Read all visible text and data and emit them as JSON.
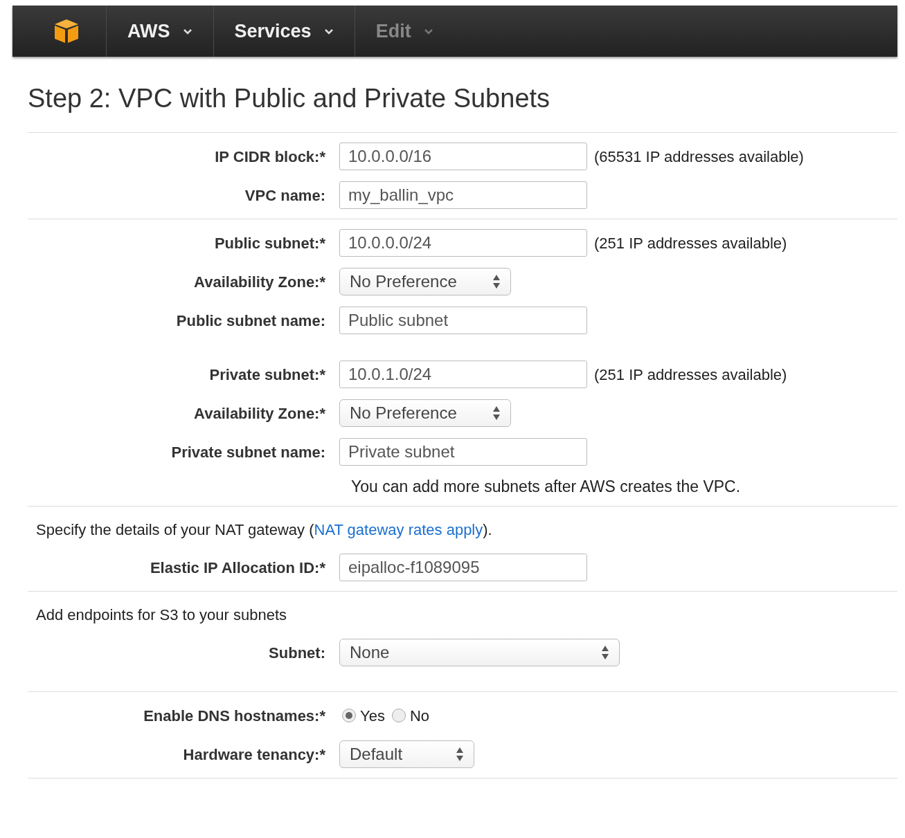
{
  "nav": {
    "items": [
      {
        "label": "AWS",
        "disabled": false
      },
      {
        "label": "Services",
        "disabled": false
      },
      {
        "label": "Edit",
        "disabled": true
      }
    ]
  },
  "title": "Step 2: VPC with Public and Private Subnets",
  "sections": [
    {
      "rows": [
        {
          "kind": "text",
          "label": "IP CIDR block:*",
          "value": "10.0.0.0/16",
          "hint": "(65531 IP addresses available)"
        },
        {
          "kind": "text",
          "label": "VPC name:",
          "value": "my_ballin_vpc"
        }
      ]
    },
    {
      "rows": [
        {
          "kind": "text",
          "label": "Public subnet:*",
          "value": "10.0.0.0/24",
          "hint": "(251 IP addresses available)"
        },
        {
          "kind": "select",
          "label": "Availability Zone:*",
          "value": "No Preference"
        },
        {
          "kind": "text",
          "label": "Public subnet name:",
          "value": "Public subnet"
        },
        {
          "kind": "gap"
        },
        {
          "kind": "text",
          "label": "Private subnet:*",
          "value": "10.0.1.0/24",
          "hint": "(251 IP addresses available)"
        },
        {
          "kind": "select",
          "label": "Availability Zone:*",
          "value": "No Preference"
        },
        {
          "kind": "text",
          "label": "Private subnet name:",
          "value": "Private subnet"
        },
        {
          "kind": "note",
          "text": "You can add more subnets after AWS creates the VPC."
        }
      ]
    },
    {
      "intro": {
        "before": "Specify the details of your NAT gateway (",
        "link": "NAT gateway rates apply",
        "after": ")."
      },
      "rows": [
        {
          "kind": "text",
          "label": "Elastic IP Allocation ID:*",
          "value": "eipalloc-f1089095"
        }
      ]
    },
    {
      "intro": {
        "before": "Add endpoints for S3 to your subnets"
      },
      "rows": [
        {
          "kind": "wideselect",
          "label": "Subnet:",
          "value": "None"
        },
        {
          "kind": "gap"
        }
      ]
    },
    {
      "rows": [
        {
          "kind": "radio",
          "label": "Enable DNS hostnames:*",
          "options": [
            {
              "label": "Yes",
              "selected": true
            },
            {
              "label": "No",
              "selected": false
            }
          ]
        },
        {
          "kind": "shortselect",
          "label": "Hardware tenancy:*",
          "value": "Default"
        }
      ]
    }
  ]
}
